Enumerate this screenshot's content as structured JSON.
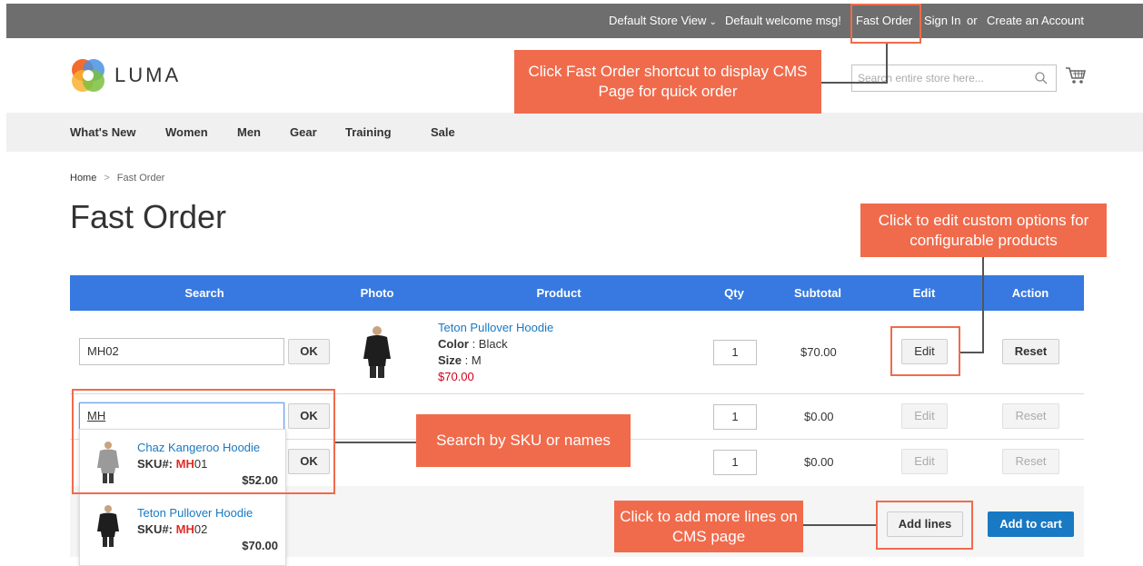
{
  "topbar": {
    "store_view": "Default Store View",
    "welcome": "Default welcome msg!",
    "fast_order": "Fast Order",
    "sign_in": "Sign In",
    "or": "or",
    "create_account": "Create an Account"
  },
  "header": {
    "logo_text": "LUMA",
    "search_placeholder": "Search entire store here..."
  },
  "nav": {
    "items": [
      "What's New",
      "Women",
      "Men",
      "Gear",
      "Training",
      "Sale"
    ]
  },
  "breadcrumb": {
    "home": "Home",
    "separator": ">",
    "current": "Fast Order"
  },
  "page_title": "Fast Order",
  "table": {
    "headers": [
      "Search",
      "Photo",
      "Product",
      "Qty",
      "Subtotal",
      "Edit",
      "Action"
    ],
    "rows": [
      {
        "sku": "MH02",
        "ok": "OK",
        "product_name": "Teton Pullover Hoodie",
        "color_label": "Color",
        "color_value": " : Black",
        "size_label": "Size",
        "size_value": " : M",
        "price": "$70.00",
        "qty": "1",
        "subtotal": "$70.00",
        "edit": "Edit",
        "reset": "Reset"
      },
      {
        "sku": "MH",
        "ok": "OK",
        "qty": "1",
        "subtotal": "$0.00",
        "edit": "Edit",
        "reset": "Reset"
      },
      {
        "ok": "OK",
        "qty": "1",
        "subtotal": "$0.00",
        "edit": "Edit",
        "reset": "Reset"
      }
    ],
    "add_lines": "Add lines",
    "add_to_cart": "Add to cart"
  },
  "dropdown": {
    "items": [
      {
        "name": "Chaz Kangeroo Hoodie",
        "sku_label": "SKU#: ",
        "sku_match": "MH",
        "sku_rest": "01",
        "price": "$52.00"
      },
      {
        "name": "Teton Pullover Hoodie",
        "sku_label": "SKU#: ",
        "sku_match": "MH",
        "sku_rest": "02",
        "price": "$70.00"
      }
    ]
  },
  "annotations": {
    "fast_order": "Click Fast Order shortcut to display CMS Page for quick order",
    "edit": "Click to edit custom options for configurable products",
    "search": "Search by SKU or names",
    "add_lines": "Click to add more lines on CMS page"
  },
  "colors": {
    "topbar": "#6e6e6e",
    "table_header": "#3779e0",
    "link": "#1979c3",
    "price_red": "#d0021b",
    "callout": "#f06b4c",
    "primary_button": "#1979c3"
  }
}
